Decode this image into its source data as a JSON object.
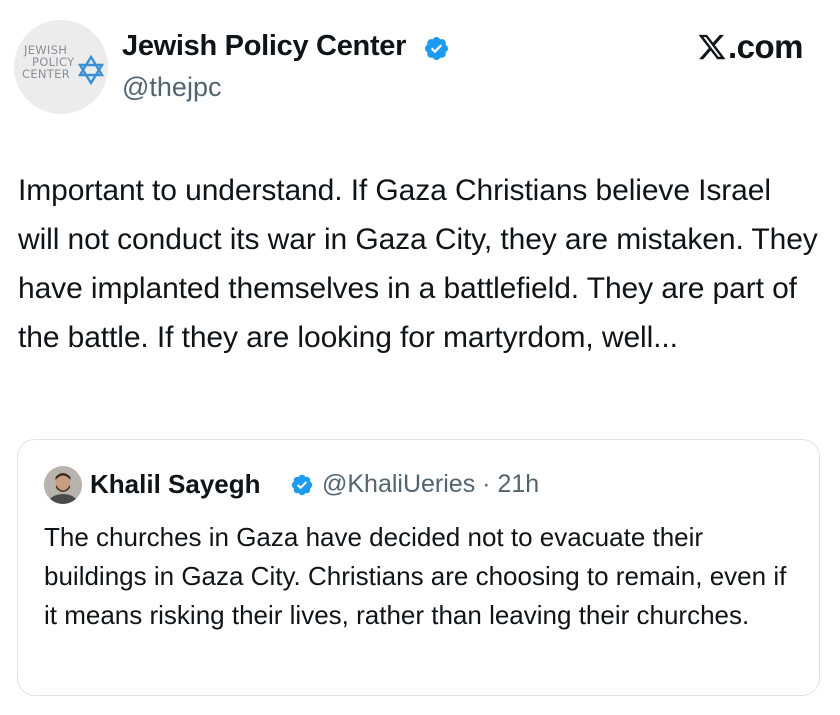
{
  "header": {
    "logo_lines": [
      "JEWISH",
      "POLICY",
      "CENTER"
    ],
    "display_name": "Jewish Policy Center",
    "handle": "@thejpc",
    "source": ".com",
    "source_icon": "x-logo-icon"
  },
  "tweet": {
    "text": "Important to understand. If Gaza Christians believe Israel will not conduct its war in Gaza City, they are mistaken. They have implanted themselves in a battlefield. They are part of the battle. If they are looking for martyrdom, well..."
  },
  "quote": {
    "display_name": "Khalil Sayegh",
    "handle": "@KhaliUeries",
    "separator": "·",
    "time": "21h",
    "text": "The churches in Gaza have decided not to evacuate their buildings in Gaza City. Christians are choosing to remain, even if it means risking their lives, rather than leaving their churches."
  },
  "colors": {
    "verified_blue": "#1d9bf0",
    "text_primary": "#0f1419",
    "text_secondary": "#536471",
    "border": "#dfe3e6"
  }
}
